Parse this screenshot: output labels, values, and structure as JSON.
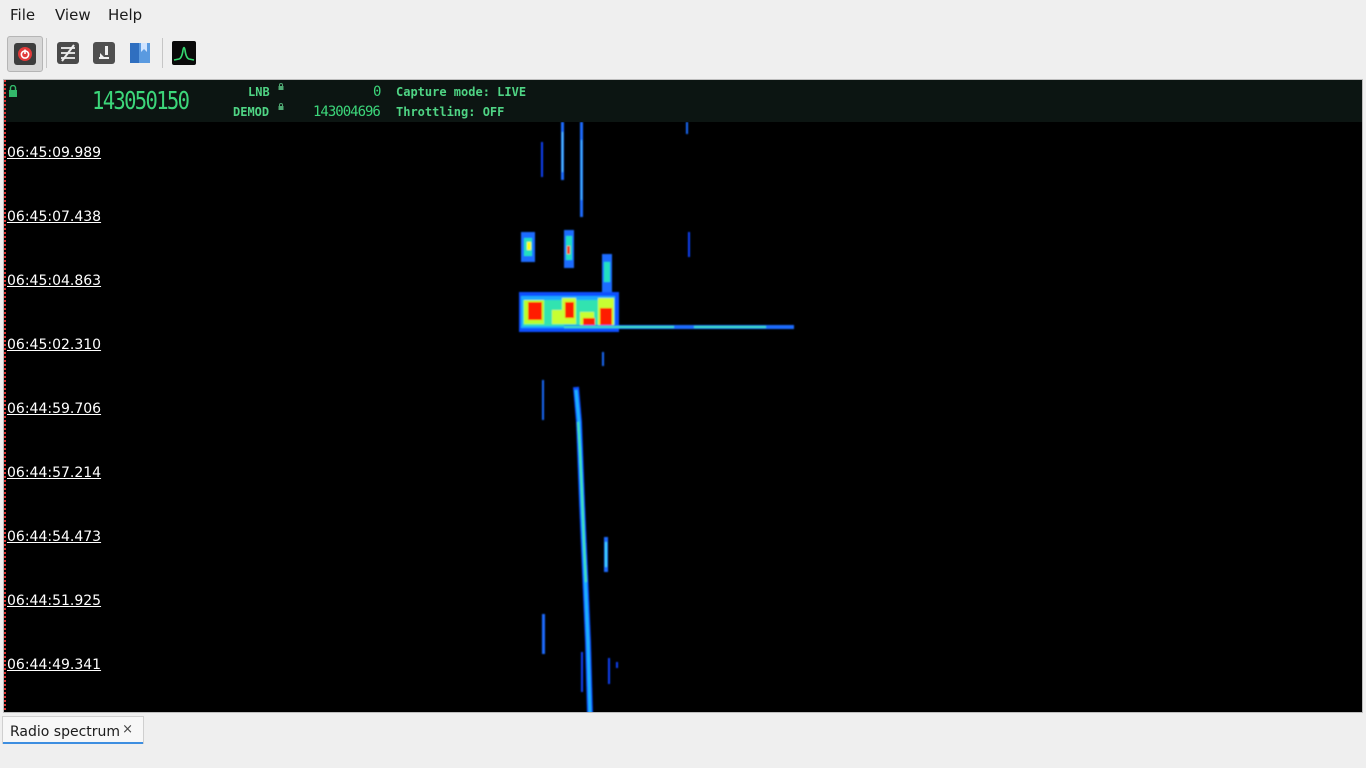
{
  "menubar": {
    "items": [
      "File",
      "View",
      "Help"
    ]
  },
  "toolbar": {
    "buttons": [
      "power-icon",
      "adjust-icon",
      "download-icon",
      "bookmark-icon",
      "spectrum-icon"
    ]
  },
  "header": {
    "main_frequency": "143050150",
    "lnb_label": "LNB",
    "lnb_value": "0",
    "demod_label": "DEMOD",
    "demod_value": "143004696",
    "capture_mode": "Capture mode: LIVE",
    "throttling": "Throttling: OFF",
    "colors": {
      "digits": "#3cd67a",
      "labels": "#4fd484",
      "strip": "#0c1512"
    }
  },
  "waterfall": {
    "timestamps": [
      "06:45:09.989",
      "06:45:07.438",
      "06:45:04.863",
      "06:45:02.310",
      "06:44:59.706",
      "06:44:57.214",
      "06:44:54.473",
      "06:44:51.925",
      "06:44:49.341"
    ],
    "colormap": [
      "#000000",
      "#0030ff",
      "#00a0ff",
      "#22e0c0",
      "#a0ff40",
      "#ffff00",
      "#ff0000"
    ]
  },
  "tabs": [
    {
      "label": "Radio spectrum",
      "close": "×"
    }
  ]
}
